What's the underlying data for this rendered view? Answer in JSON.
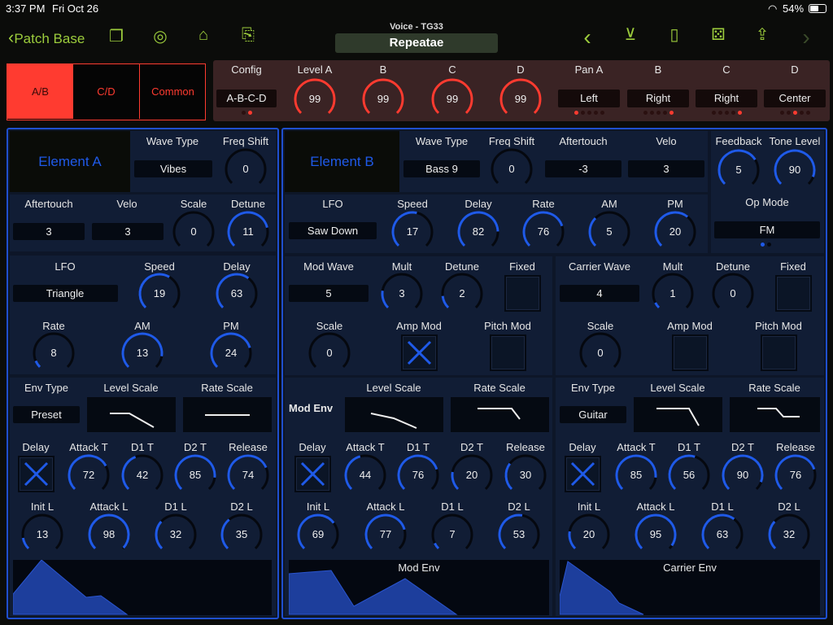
{
  "status_bar": {
    "time": "3:37 PM",
    "date": "Fri Oct 26",
    "battery": "54%"
  },
  "nav": {
    "back_label": "Patch Base",
    "subtitle": "Voice - TG33",
    "patch_name": "Repeatae",
    "icons_left": [
      "windows-icon",
      "midi-icon",
      "piano-icon",
      "copy-icon"
    ],
    "icons_right": [
      "chevron-left-icon",
      "keyboard-download-icon",
      "document-icon",
      "dice-icon",
      "share-icon",
      "chevron-right-icon"
    ]
  },
  "colors": {
    "accent_green": "#9ccc3c",
    "accent_red": "#ff3b30",
    "accent_blue": "#1f5ae8"
  },
  "tabs": [
    {
      "label": "A/B",
      "selected": true
    },
    {
      "label": "C/D",
      "selected": false
    },
    {
      "label": "Common",
      "selected": false
    }
  ],
  "header": {
    "config": {
      "label": "Config",
      "value": "A-B-C-D",
      "options": 2,
      "selected": 1
    },
    "levels": [
      {
        "label": "Level A",
        "value": 99,
        "max": 99
      },
      {
        "label": "B",
        "value": 99,
        "max": 99
      },
      {
        "label": "C",
        "value": 99,
        "max": 99
      },
      {
        "label": "D",
        "value": 99,
        "max": 99
      }
    ],
    "pans": [
      {
        "label": "Pan A",
        "value": "Left",
        "options": 5,
        "selected": 0
      },
      {
        "label": "B",
        "value": "Right",
        "options": 5,
        "selected": 4
      },
      {
        "label": "C",
        "value": "Right",
        "options": 5,
        "selected": 4
      },
      {
        "label": "D",
        "value": "Center",
        "options": 5,
        "selected": 2
      }
    ]
  },
  "element_a": {
    "title": "Element A",
    "wave_type": {
      "label": "Wave Type",
      "value": "Vibes"
    },
    "freq_shift": {
      "label": "Freq Shift",
      "value": 0,
      "max": 99
    },
    "aftertouch": {
      "label": "Aftertouch",
      "value": "3"
    },
    "velo": {
      "label": "Velo",
      "value": "3"
    },
    "scale": {
      "label": "Scale",
      "value": 0,
      "max": 3
    },
    "detune": {
      "label": "Detune",
      "value": 11,
      "max": 14
    },
    "lfo": {
      "label": "LFO",
      "value": "Triangle"
    },
    "speed": {
      "label": "Speed",
      "value": 19,
      "max": 31
    },
    "delay": {
      "label": "Delay",
      "value": 63,
      "max": 99
    },
    "rate": {
      "label": "Rate",
      "value": 8,
      "max": 99
    },
    "am": {
      "label": "AM",
      "value": 13,
      "max": 15
    },
    "pm": {
      "label": "PM",
      "value": 24,
      "max": 31
    },
    "env_type": {
      "label": "Env Type",
      "value": "Preset"
    },
    "level_scale": {
      "label": "Level Scale"
    },
    "rate_scale": {
      "label": "Rate Scale"
    },
    "env_delay": {
      "label": "Delay",
      "checked": true
    },
    "attack_t": {
      "label": "Attack T",
      "value": 72,
      "max": 99
    },
    "d1_t": {
      "label": "D1 T",
      "value": 42,
      "max": 99
    },
    "d2_t": {
      "label": "D2 T",
      "value": 85,
      "max": 99
    },
    "release": {
      "label": "Release",
      "value": 74,
      "max": 99
    },
    "init_l": {
      "label": "Init L",
      "value": 13,
      "max": 99
    },
    "attack_l": {
      "label": "Attack L",
      "value": 98,
      "max": 99
    },
    "d1_l": {
      "label": "D1 L",
      "value": 32,
      "max": 99
    },
    "d2_l": {
      "label": "D2 L",
      "value": 35,
      "max": 99
    }
  },
  "element_b": {
    "title": "Element B",
    "wave_type": {
      "label": "Wave Type",
      "value": "Bass 9"
    },
    "freq_shift": {
      "label": "Freq Shift",
      "value": 0,
      "max": 99
    },
    "aftertouch": {
      "label": "Aftertouch",
      "value": "-3"
    },
    "velo": {
      "label": "Velo",
      "value": "3"
    },
    "lfo": {
      "label": "LFO",
      "value": "Saw Down"
    },
    "speed": {
      "label": "Speed",
      "value": 17,
      "max": 31
    },
    "delay": {
      "label": "Delay",
      "value": 82,
      "max": 99
    },
    "rate": {
      "label": "Rate",
      "value": 76,
      "max": 99
    },
    "am": {
      "label": "AM",
      "value": 5,
      "max": 15
    },
    "pm": {
      "label": "PM",
      "value": 20,
      "max": 31
    },
    "feedback": {
      "label": "Feedback",
      "value": 5,
      "max": 7
    },
    "tone_level": {
      "label": "Tone Level",
      "value": 90,
      "max": 99
    },
    "op_mode": {
      "label": "Op Mode",
      "value": "FM",
      "options": 2,
      "selected": 0
    },
    "mod": {
      "wave": {
        "label": "Mod Wave",
        "value": "5"
      },
      "mult": {
        "label": "Mult",
        "value": 3,
        "max": 15
      },
      "detune": {
        "label": "Detune",
        "value": 2,
        "max": 14
      },
      "fixed": {
        "label": "Fixed",
        "checked": false
      },
      "scale": {
        "label": "Scale",
        "value": 0,
        "max": 3
      },
      "amp_mod": {
        "label": "Amp Mod",
        "checked": true
      },
      "pitch_mod": {
        "label": "Pitch Mod",
        "checked": false
      },
      "env_title": "Mod Env",
      "level_scale": {
        "label": "Level Scale"
      },
      "rate_scale": {
        "label": "Rate Scale"
      },
      "env_delay": {
        "label": "Delay",
        "checked": true
      },
      "attack_t": {
        "label": "Attack T",
        "value": 44,
        "max": 99
      },
      "d1_t": {
        "label": "D1 T",
        "value": 76,
        "max": 99
      },
      "d2_t": {
        "label": "D2 T",
        "value": 20,
        "max": 99
      },
      "release": {
        "label": "Release",
        "value": 30,
        "max": 99
      },
      "init_l": {
        "label": "Init L",
        "value": 69,
        "max": 99
      },
      "attack_l": {
        "label": "Attack L",
        "value": 77,
        "max": 99
      },
      "d1_l": {
        "label": "D1 L",
        "value": 7,
        "max": 99
      },
      "d2_l": {
        "label": "D2 L",
        "value": 53,
        "max": 99
      },
      "graph_label": "Mod Env"
    },
    "carrier": {
      "wave": {
        "label": "Carrier Wave",
        "value": "4"
      },
      "mult": {
        "label": "Mult",
        "value": 1,
        "max": 15
      },
      "detune": {
        "label": "Detune",
        "value": 0,
        "max": 14
      },
      "fixed": {
        "label": "Fixed",
        "checked": false
      },
      "scale": {
        "label": "Scale",
        "value": 0,
        "max": 3
      },
      "amp_mod": {
        "label": "Amp Mod",
        "checked": false
      },
      "pitch_mod": {
        "label": "Pitch Mod",
        "checked": false
      },
      "env_type": {
        "label": "Env Type",
        "value": "Guitar"
      },
      "level_scale": {
        "label": "Level Scale"
      },
      "rate_scale": {
        "label": "Rate Scale"
      },
      "env_delay": {
        "label": "Delay",
        "checked": true
      },
      "attack_t": {
        "label": "Attack T",
        "value": 85,
        "max": 99
      },
      "d1_t": {
        "label": "D1 T",
        "value": 56,
        "max": 99
      },
      "d2_t": {
        "label": "D2 T",
        "value": 90,
        "max": 99
      },
      "release": {
        "label": "Release",
        "value": 76,
        "max": 99
      },
      "init_l": {
        "label": "Init L",
        "value": 20,
        "max": 99
      },
      "attack_l": {
        "label": "Attack L",
        "value": 95,
        "max": 99
      },
      "d1_l": {
        "label": "D1 L",
        "value": 63,
        "max": 99
      },
      "d2_l": {
        "label": "D2 L",
        "value": 32,
        "max": 99
      },
      "graph_label": "Carrier Env"
    }
  }
}
